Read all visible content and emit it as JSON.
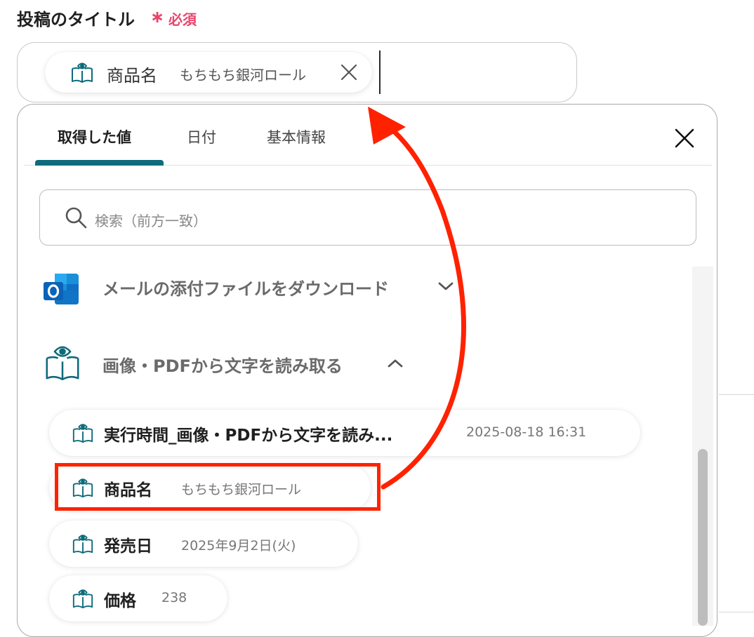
{
  "field": {
    "label": "投稿のタイトル",
    "required_star": "∗",
    "required_text": "必須"
  },
  "title_input": {
    "chip": {
      "label": "商品名",
      "value": "もちもち銀河ロール",
      "icon": "book-eye-icon",
      "remove_icon": "close-icon"
    }
  },
  "popup": {
    "tabs": [
      {
        "label": "取得した値",
        "active": true
      },
      {
        "label": "日付",
        "active": false
      },
      {
        "label": "基本情報",
        "active": false
      }
    ],
    "close_icon": "close-icon",
    "search": {
      "placeholder": "検索（前方一致）",
      "icon": "search-icon"
    },
    "groups": [
      {
        "title": "メールの添付ファイルをダウンロード",
        "icon": "outlook-icon",
        "expanded": false
      },
      {
        "title": "画像・PDFから文字を読み取る",
        "icon": "book-eye-icon",
        "expanded": true
      }
    ],
    "items": [
      {
        "label": "実行時間_画像・PDFから文字を読み...",
        "value": "2025-08-18 16:31"
      },
      {
        "label": "商品名",
        "value": "もちもち銀河ロール",
        "highlighted": true
      },
      {
        "label": "発売日",
        "value": "2025年9月2日(火)"
      },
      {
        "label": "価格",
        "value": "238"
      }
    ]
  },
  "colors": {
    "accent": "#0d6b7b",
    "required": "#e8456b",
    "annotation": "#ff2200"
  }
}
